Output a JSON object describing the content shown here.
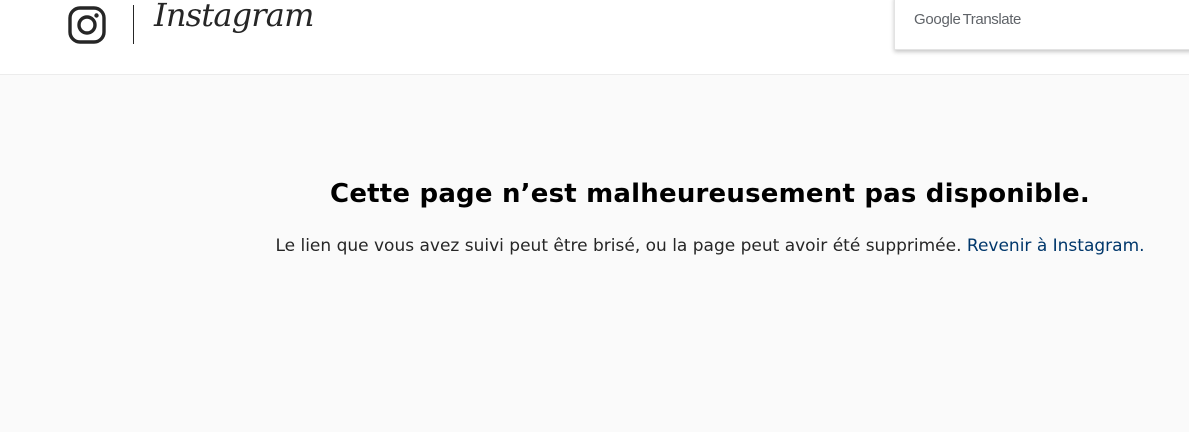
{
  "header": {
    "logo_icon": "instagram-camera-icon",
    "wordmark": "Instagram"
  },
  "google_translate": {
    "brand": "Google",
    "label": "Translate"
  },
  "error": {
    "title": "Cette page n’est malheureusement pas disponible.",
    "message": "Le lien que vous avez suivi peut être brisé, ou la page peut avoir été supprimée.",
    "link_label": "Revenir à Instagram."
  },
  "colors": {
    "page_background": "#fafafa",
    "header_background": "#ffffff",
    "link": "#00376b",
    "text": "#262626"
  }
}
